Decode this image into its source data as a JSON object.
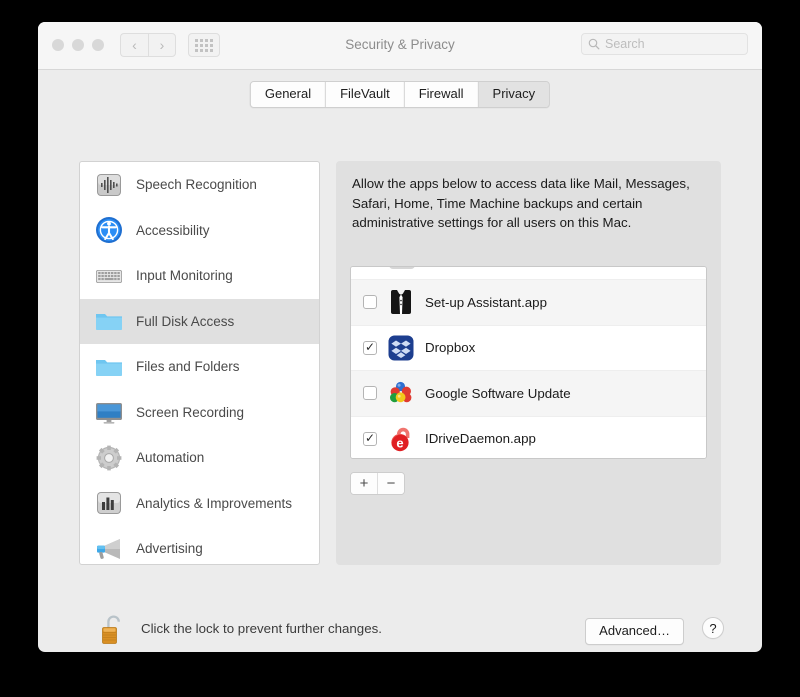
{
  "window": {
    "title": "Security & Privacy",
    "traffic_lights": [
      "close",
      "minimize",
      "zoom"
    ],
    "nav": {
      "back": "‹",
      "forward": "›",
      "grid": "all-preferences"
    }
  },
  "search": {
    "placeholder": "Search",
    "value": "",
    "icon": "search-icon"
  },
  "tabs": [
    {
      "label": "General",
      "selected": false
    },
    {
      "label": "FileVault",
      "selected": false
    },
    {
      "label": "Firewall",
      "selected": false
    },
    {
      "label": "Privacy",
      "selected": true
    }
  ],
  "sidebar": {
    "items": [
      {
        "label": "Speech Recognition",
        "icon": "waveform-icon",
        "selected": false
      },
      {
        "label": "Accessibility",
        "icon": "accessibility-icon",
        "selected": false
      },
      {
        "label": "Input Monitoring",
        "icon": "keyboard-icon",
        "selected": false
      },
      {
        "label": "Full Disk Access",
        "icon": "folder-icon",
        "selected": true
      },
      {
        "label": "Files and Folders",
        "icon": "folder-icon",
        "selected": false
      },
      {
        "label": "Screen Recording",
        "icon": "display-icon",
        "selected": false
      },
      {
        "label": "Automation",
        "icon": "gear-icon",
        "selected": false
      },
      {
        "label": "Analytics & Improvements",
        "icon": "bar-chart-icon",
        "selected": false
      },
      {
        "label": "Advertising",
        "icon": "megaphone-icon",
        "selected": false
      }
    ]
  },
  "pane": {
    "description": "Allow the apps below to access data like Mail, Messages, Safari, Home, Time Machine backups and certain administrative settings for all users on this Mac.",
    "apps": [
      {
        "name": "Set-up Assistant.app",
        "checked": false,
        "icon": "tuxedo-icon"
      },
      {
        "name": "Dropbox",
        "checked": true,
        "icon": "dropbox-icon"
      },
      {
        "name": "Google Software Update",
        "checked": false,
        "icon": "google-spheres-icon"
      },
      {
        "name": "IDriveDaemon.app",
        "checked": true,
        "icon": "idrive-icon"
      }
    ],
    "add_label": "+",
    "remove_label": "−",
    "checkmark": "✓"
  },
  "bottom": {
    "lock_icon": "unlocked-padlock-icon",
    "lock_text": "Click the lock to prevent further changes.",
    "advanced_label": "Advanced…",
    "help_label": "?"
  },
  "colors": {
    "window_bg": "#ececec",
    "titlebar_bg": "#f6f6f6",
    "pane_bg": "#e0e0e0",
    "selected_row": "#e0e0e0",
    "accent_blue": "#5bc0f5",
    "dropbox_blue": "#1e3d8f",
    "idrive_red": "#e01f23",
    "lock_gold": "#e8a33d"
  }
}
